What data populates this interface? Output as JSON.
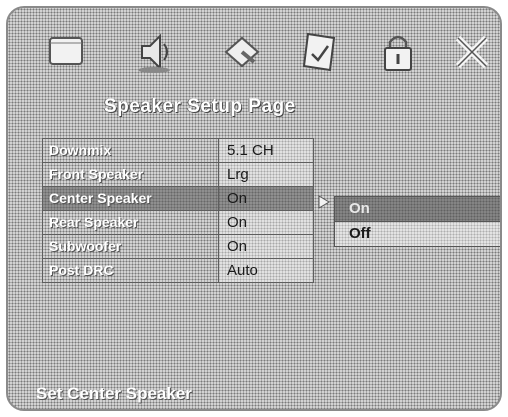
{
  "header": {
    "icons": [
      "language-icon",
      "audio-icon",
      "video-icon",
      "speaker-setup-icon",
      "password-icon",
      "exit-icon"
    ]
  },
  "page_title": "Speaker Setup Page",
  "menu": {
    "items": [
      {
        "label": "Downmix",
        "value": "5.1 CH"
      },
      {
        "label": "Front Speaker",
        "value": "Lrg"
      },
      {
        "label": "Center Speaker",
        "value": "On"
      },
      {
        "label": "Rear Speaker",
        "value": "On"
      },
      {
        "label": "Subwoofer",
        "value": "On"
      },
      {
        "label": "Post DRC",
        "value": "Auto"
      }
    ],
    "selected_index": 2
  },
  "submenu": {
    "options": [
      "On",
      "Off"
    ],
    "selected_index": 0
  },
  "footer": {
    "text": "Set Center Speaker"
  }
}
